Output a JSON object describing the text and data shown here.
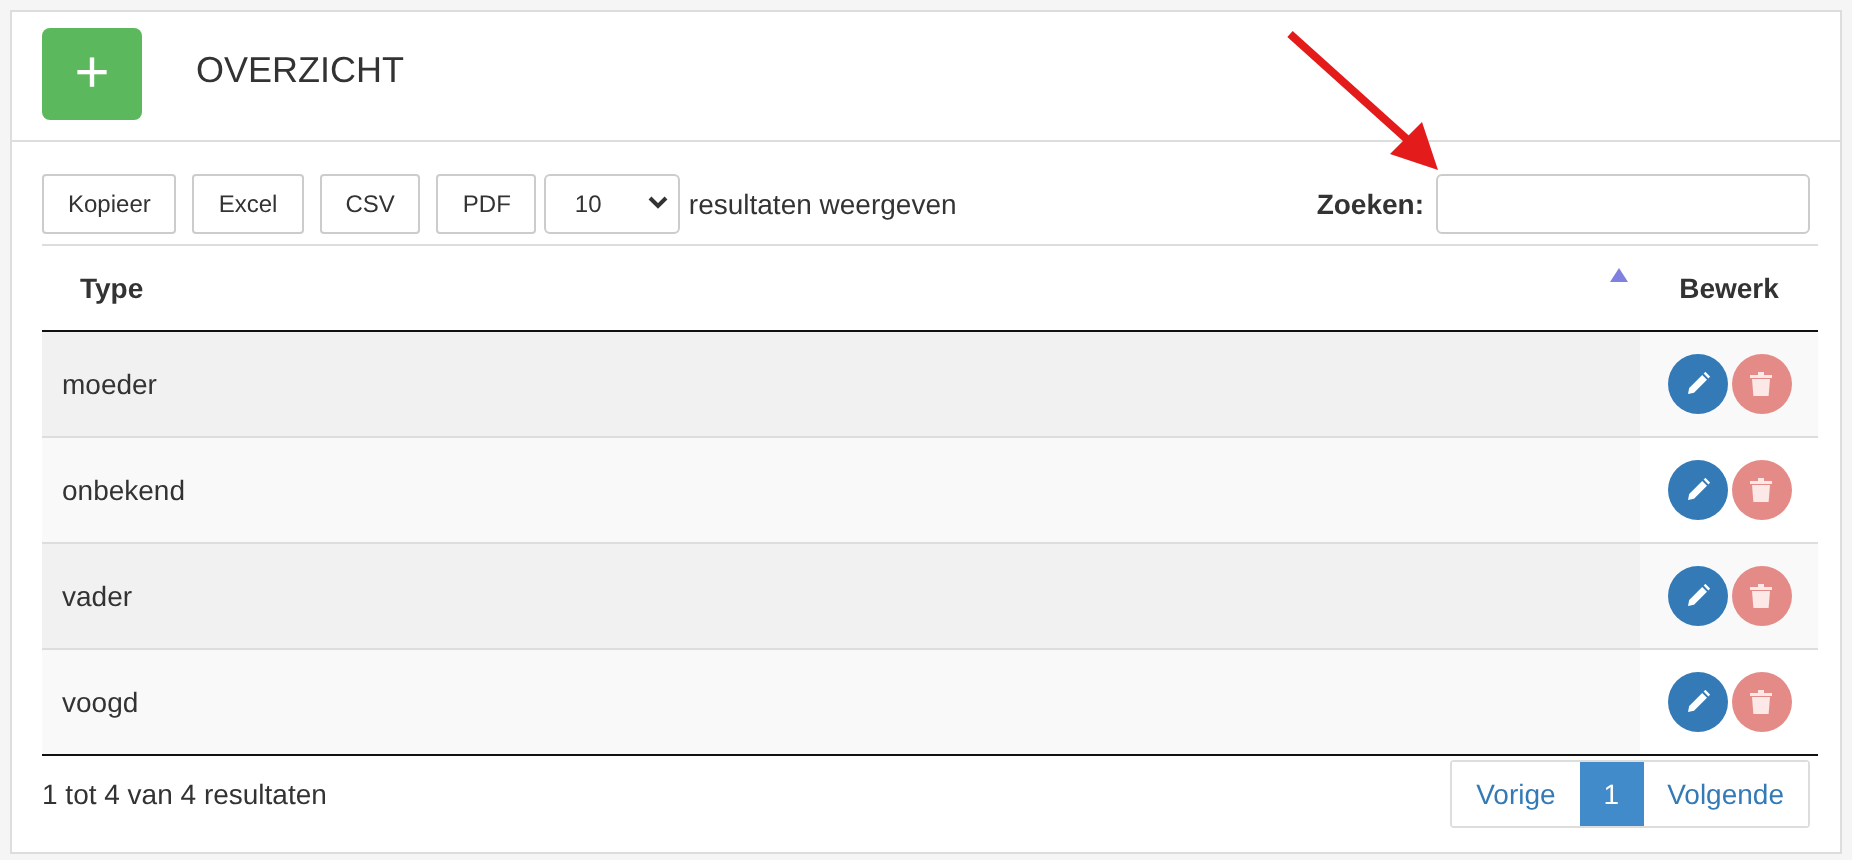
{
  "header": {
    "add_button": "+",
    "title": "OVERZICHT"
  },
  "toolbar": {
    "buttons": [
      "Kopieer",
      "Excel",
      "CSV",
      "PDF"
    ],
    "page_size": "10",
    "page_size_label": "resultaten weergeven",
    "search_label": "Zoeken:"
  },
  "table": {
    "columns": [
      {
        "label": "Type",
        "sorted": true
      },
      {
        "label": "Bewerk",
        "sorted": false
      }
    ],
    "rows": [
      {
        "type": "moeder"
      },
      {
        "type": "onbekend"
      },
      {
        "type": "vader"
      },
      {
        "type": "voogd"
      }
    ]
  },
  "footer": {
    "info": "1 tot 4 van 4 resultaten",
    "pagination": [
      {
        "label": "Vorige",
        "selected": false
      },
      {
        "label": "1",
        "selected": true
      },
      {
        "label": "Volgende",
        "selected": false
      }
    ]
  }
}
